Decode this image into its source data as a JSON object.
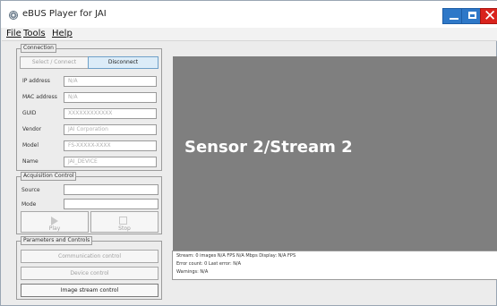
{
  "window": {
    "title": "eBUS Player for JAI"
  },
  "menu": [
    "File",
    "Tools",
    "Help"
  ],
  "connection": {
    "legend": "Connection",
    "select_connect_label": "Select / Connect",
    "disconnect_label": "Disconnect",
    "fields": [
      {
        "label": "IP address",
        "value": "N/A"
      },
      {
        "label": "MAC address",
        "value": "N/A"
      },
      {
        "label": "GUID",
        "value": "XXXXXXXXXXXX"
      },
      {
        "label": "Vendor",
        "value": "JAI Corporation"
      },
      {
        "label": "Model",
        "value": "FS-XXXXX-XXXX"
      },
      {
        "label": "Name",
        "value": "JAI_DEVICE"
      }
    ]
  },
  "acquisition": {
    "legend": "Acquisition Control",
    "source_label": "Source",
    "mode_label": "Mode",
    "source_value": "",
    "mode_value": "",
    "play_label": "Play",
    "stop_label": "Stop"
  },
  "parameters": {
    "legend": "Parameters and Controls",
    "communication_label": "Communication control",
    "device_label": "Device control",
    "image_stream_label": "Image stream control"
  },
  "display": {
    "overlay_text": "Sensor 2/Stream 2"
  },
  "status": {
    "line1": "Stream: 0 images   N/A FPS    N/A Mbps    Display: N/A FPS",
    "line2": "Error count: 0   Last error: N/A",
    "line3": "Warnings: N/A"
  },
  "colors": {
    "video_bg": "#7f7f7f",
    "titlebar_close": "#d9231d",
    "titlebar_buttons": "#2e78c8"
  },
  "icons": {
    "app": "ebus-app-icon",
    "play": "play-icon",
    "stop": "stop-icon"
  }
}
